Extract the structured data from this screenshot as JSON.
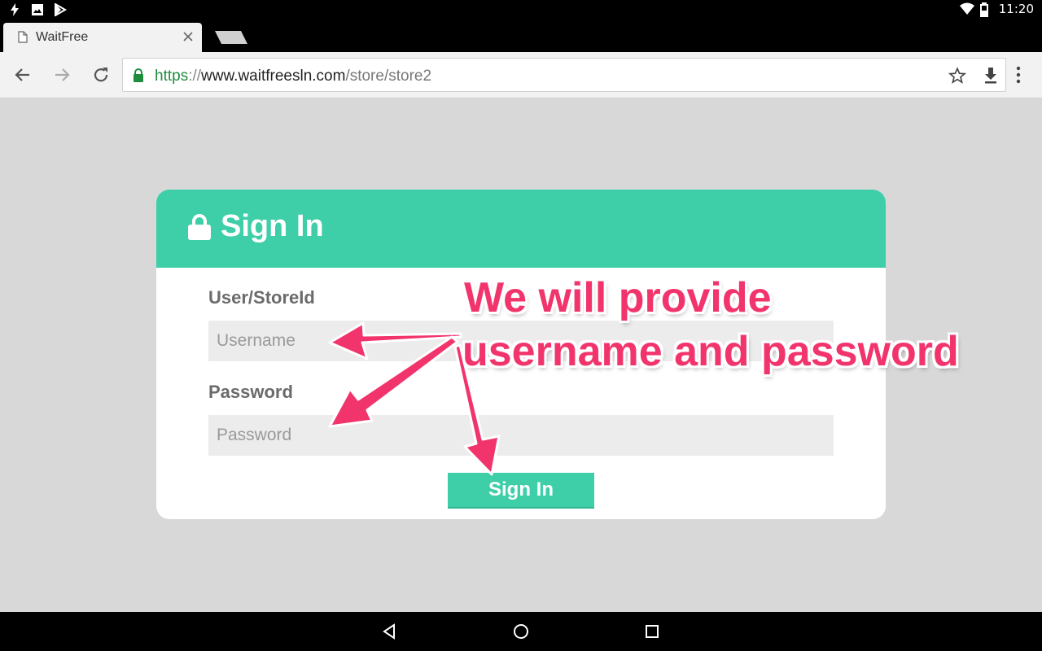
{
  "status_bar": {
    "time": "11:20",
    "left_icons": [
      "flash-icon",
      "image-icon",
      "play-store-icon"
    ],
    "right_icons": [
      "wifi-icon",
      "battery-icon"
    ]
  },
  "browser": {
    "tab": {
      "title": "WaitFree"
    },
    "url": {
      "scheme": "https",
      "separator": "://",
      "host": "www.waitfreesln.com",
      "path": "/store/store2"
    }
  },
  "signin": {
    "title": "Sign In",
    "username_label": "User/StoreId",
    "username_placeholder": "Username",
    "password_label": "Password",
    "password_placeholder": "Password",
    "button_label": "Sign In"
  },
  "annotation": {
    "line1": "We will provide",
    "line2": "username and password"
  },
  "colors": {
    "accent": "#3ecfa8",
    "annotation": "#f2346c"
  }
}
